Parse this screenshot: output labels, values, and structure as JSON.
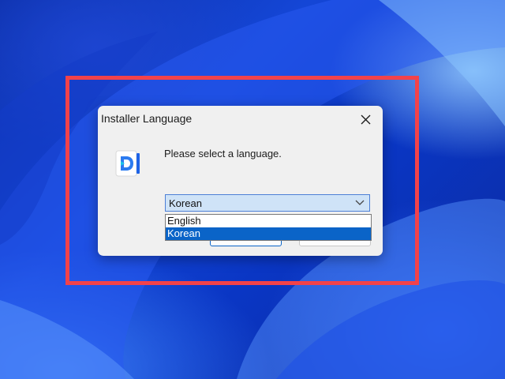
{
  "dialog": {
    "title": "Installer Language",
    "prompt": "Please select a language.",
    "icon": "app-logo-icon",
    "close_icon": "close-icon"
  },
  "language_select": {
    "value": "Korean",
    "options": [
      {
        "label": "English",
        "selected": false
      },
      {
        "label": "Korean",
        "selected": true
      }
    ]
  },
  "buttons": {
    "ok_label": "",
    "cancel_label": ""
  },
  "colors": {
    "highlight": "#f2424a",
    "selection": "#0a64c8",
    "wallpaper": "#1446d6"
  }
}
